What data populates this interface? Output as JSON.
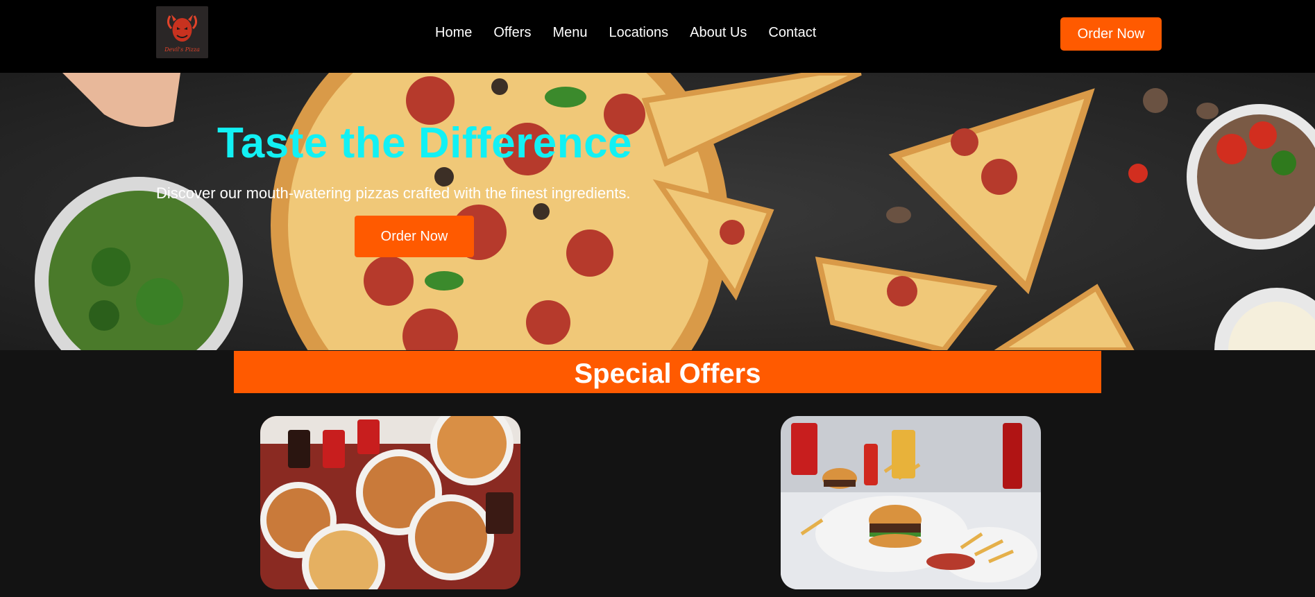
{
  "brand": {
    "logo_text": "Devil's Pizza"
  },
  "nav": {
    "items": [
      "Home",
      "Offers",
      "Menu",
      "Locations",
      "About Us",
      "Contact"
    ]
  },
  "header": {
    "order_button": "Order Now"
  },
  "hero": {
    "title": "Taste the Difference",
    "subtitle": "Discover our mouth-watering pizzas crafted with the finest ingredients.",
    "cta": "Order Now",
    "title_color": "#12f1f4"
  },
  "offers": {
    "heading": "Special Offers"
  },
  "colors": {
    "accent": "#ff5a00",
    "header_bg": "#000000",
    "page_bg": "#131313"
  }
}
